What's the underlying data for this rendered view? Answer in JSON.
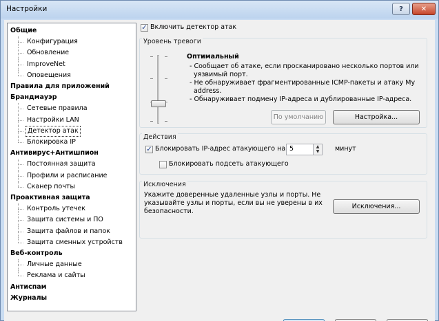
{
  "window": {
    "title": "Настройки",
    "help_label": "?",
    "close_label": "✕"
  },
  "tree": {
    "items": [
      {
        "label": "Общие",
        "kind": "cat"
      },
      {
        "label": "Конфигурация",
        "kind": "sub"
      },
      {
        "label": "Обновление",
        "kind": "sub"
      },
      {
        "label": "ImproveNet",
        "kind": "sub"
      },
      {
        "label": "Оповещения",
        "kind": "sub"
      },
      {
        "label": "Правила для приложений",
        "kind": "cat"
      },
      {
        "label": "Брандмауэр",
        "kind": "cat"
      },
      {
        "label": "Сетевые правила",
        "kind": "sub"
      },
      {
        "label": "Настройки LAN",
        "kind": "sub"
      },
      {
        "label": "Детектор атак",
        "kind": "sub",
        "selected": true
      },
      {
        "label": "Блокировка IP",
        "kind": "sub"
      },
      {
        "label": "Антивирус+Антишпион",
        "kind": "cat"
      },
      {
        "label": "Постоянная защита",
        "kind": "sub"
      },
      {
        "label": "Профили и расписание",
        "kind": "sub"
      },
      {
        "label": "Сканер почты",
        "kind": "sub"
      },
      {
        "label": "Проактивная защита",
        "kind": "cat"
      },
      {
        "label": "Контроль утечек",
        "kind": "sub"
      },
      {
        "label": "Защита системы и ПО",
        "kind": "sub"
      },
      {
        "label": "Защита файлов и папок",
        "kind": "sub"
      },
      {
        "label": "Защита сменных устройств",
        "kind": "sub"
      },
      {
        "label": "Веб-контроль",
        "kind": "cat"
      },
      {
        "label": "Личные данные",
        "kind": "sub"
      },
      {
        "label": "Реклама и сайты",
        "kind": "sub"
      },
      {
        "label": "Антиспам",
        "kind": "cat"
      },
      {
        "label": "Журналы",
        "kind": "cat"
      }
    ]
  },
  "main": {
    "enable_detector": {
      "label": "Включить детектор атак",
      "checked": true
    },
    "alert_level": {
      "title": "Уровень тревоги",
      "level_name": "Оптимальный",
      "description": [
        "- Сообщает об атаке, если просканировано несколько портов или",
        "  уязвимый порт.",
        "- Не обнаруживает фрагментированные ICMP-пакеты и атаку My",
        "  address.",
        "- Обнаруживает подмену IP-адреса и дублированные IP-адреса."
      ],
      "default_button": "По умолчанию",
      "settings_button": "Настройка..."
    },
    "actions": {
      "title": "Действия",
      "block_ip": {
        "label": "Блокировать IP-адрес атакующего на",
        "checked": true
      },
      "block_minutes_value": "5",
      "minutes_label": "минут",
      "block_subnet": {
        "label": "Блокировать подсеть атакующего",
        "checked": false
      }
    },
    "exclusions": {
      "title": "Исключения",
      "description": [
        "Укажите доверенные удаленные узлы и порты. Не",
        "указывайте узлы и порты, если вы не уверены в их",
        "безопасности."
      ],
      "button": "Исключения..."
    }
  }
}
